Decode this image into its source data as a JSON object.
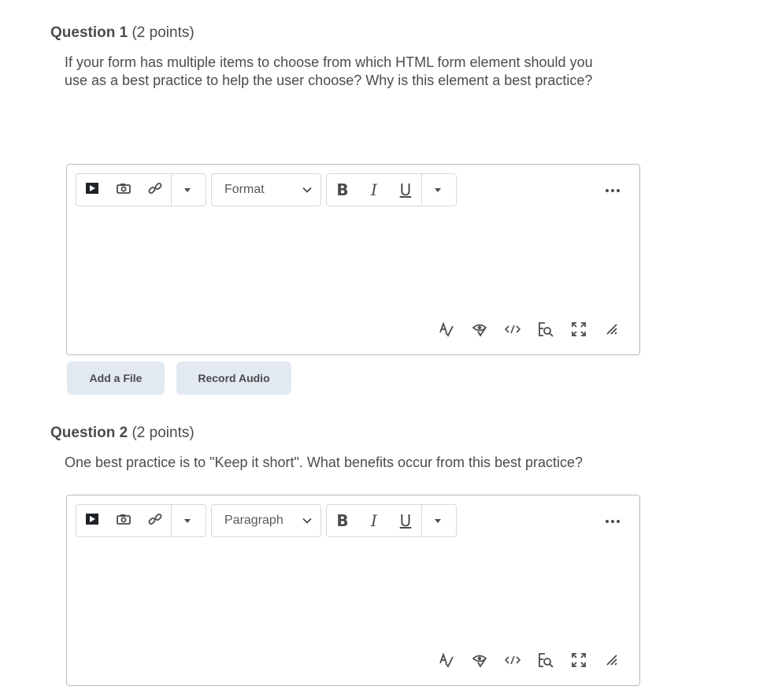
{
  "questions": [
    {
      "title": "Question 1",
      "points": "(2 points)",
      "prompt": "If your form has multiple items to choose from which HTML form element should you use as a best practice to help the user choose? Why is this element a best practice?",
      "editor": {
        "format_label": "Format"
      }
    },
    {
      "title": "Question 2",
      "points": "(2 points)",
      "prompt": "One best practice is to \"Keep it short\". What benefits occur from this best practice?",
      "editor": {
        "format_label": "Paragraph"
      }
    }
  ],
  "toolbar": {
    "bold": "B",
    "italic": "I",
    "underline": "U"
  },
  "actions": {
    "add_file": "Add a File",
    "record_audio": "Record Audio"
  },
  "icons": [
    "video-icon",
    "image-icon",
    "link-icon",
    "dropdown-icon",
    "bold-icon",
    "italic-icon",
    "underline-icon",
    "more-icon",
    "spellcheck-icon",
    "accessibility-icon",
    "source-code-icon",
    "preview-icon",
    "fullscreen-icon",
    "resize-icon"
  ]
}
